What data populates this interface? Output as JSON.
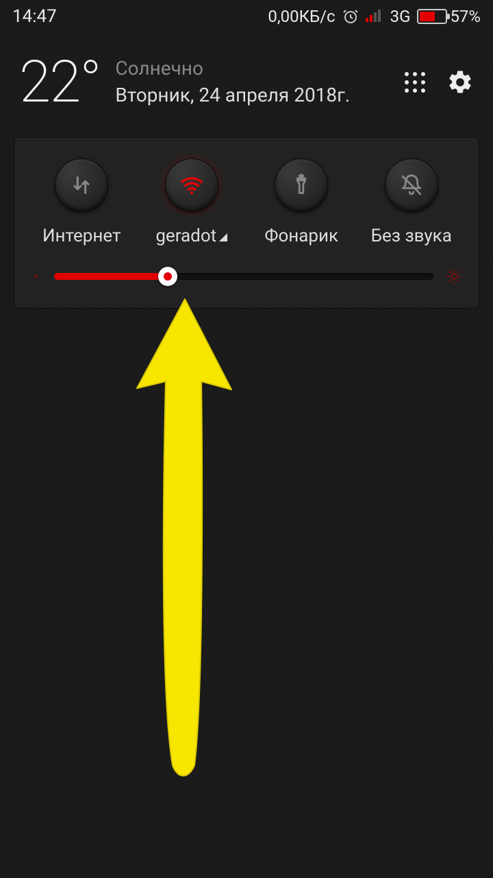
{
  "status": {
    "time": "14:47",
    "speed": "0,00КБ/с",
    "network": "3G",
    "battery_pct": "57%"
  },
  "weather": {
    "temp": "22°",
    "condition": "Солнечно",
    "date": "Вторник, 24 апреля 2018г."
  },
  "toggles": {
    "internet": "Интернет",
    "wifi": "geradot",
    "flashlight": "Фонарик",
    "silent": "Без звука"
  },
  "colors": {
    "accent": "#e40000",
    "arrow": "#f7e600"
  },
  "brightness": {
    "percent": 30
  }
}
